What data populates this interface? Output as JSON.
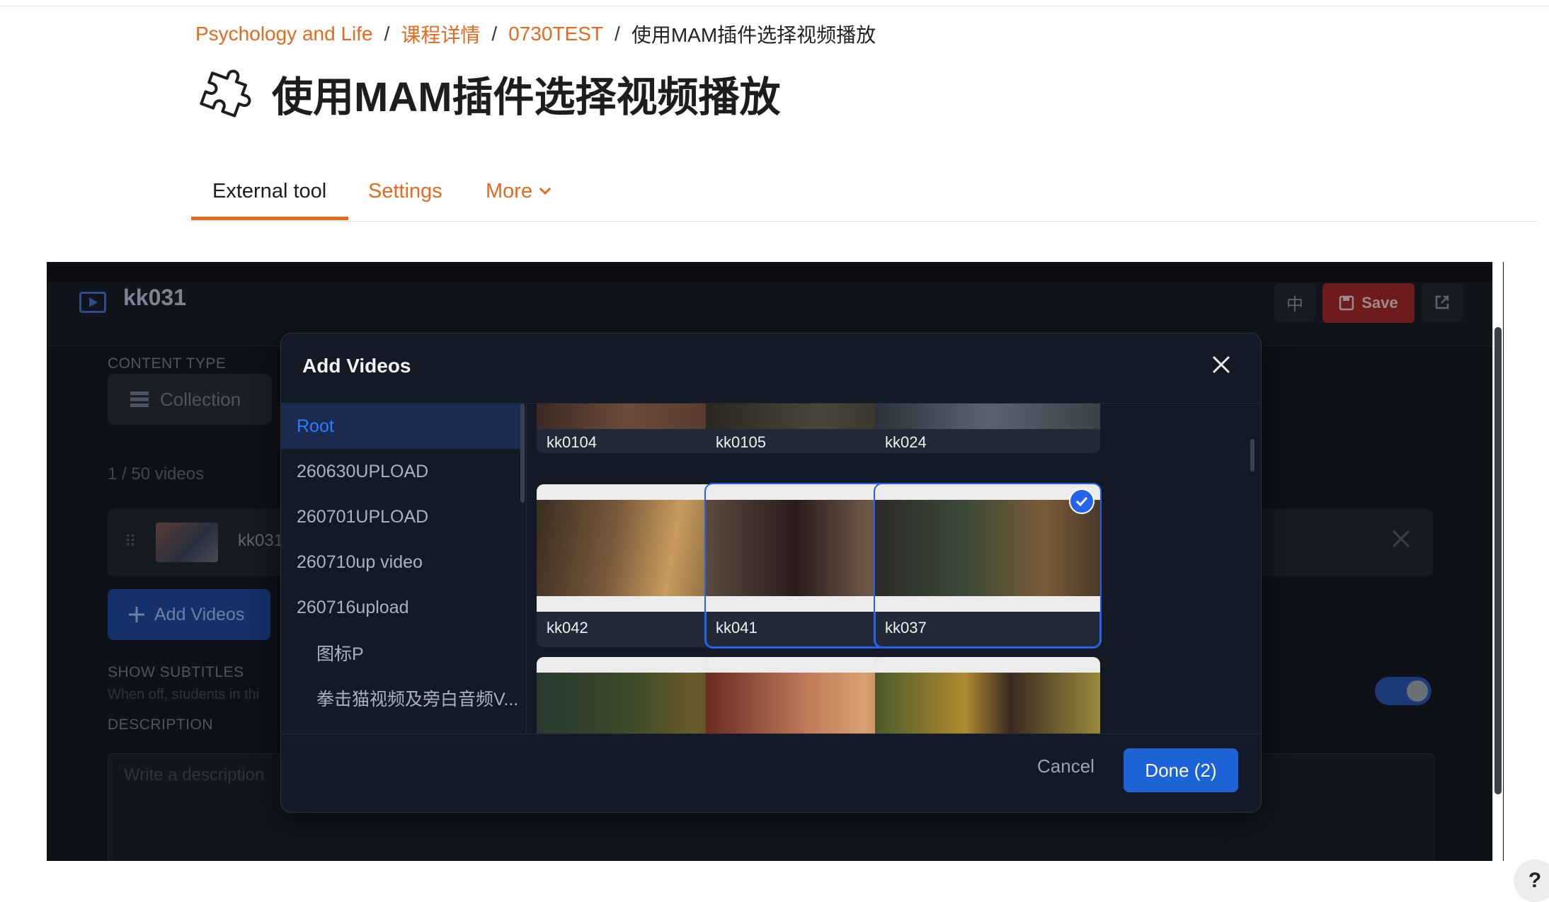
{
  "breadcrumb": {
    "course": "Psychology and Life",
    "details": "课程详情",
    "section": "0730TEST",
    "current": "使用MAM插件选择视频播放",
    "separator": "/"
  },
  "page": {
    "title": "使用MAM插件选择视频播放",
    "icon": "puzzle-icon"
  },
  "tabs": {
    "external_tool": "External tool",
    "settings": "Settings",
    "more": "More"
  },
  "tool": {
    "title": "kk031",
    "lang": "中",
    "save": "Save",
    "content_type_label": "CONTENT TYPE",
    "collection": "Collection",
    "count": "1 / 50 videos",
    "row_name": "kk031",
    "add_videos": "Add Videos",
    "subtitles_label": "SHOW SUBTITLES",
    "subtitles_hint": "When off, students in thi",
    "description_label": "DESCRIPTION",
    "description_placeholder": "Write a description"
  },
  "modal": {
    "title": "Add Videos",
    "folders": [
      {
        "name": "Root",
        "active": true
      },
      {
        "name": "260630UPLOAD"
      },
      {
        "name": "260701UPLOAD"
      },
      {
        "name": "260710up video"
      },
      {
        "name": "260716upload"
      },
      {
        "name": "图标P",
        "sub": true
      },
      {
        "name": "拳击猫视频及旁白音频V...",
        "sub": true
      }
    ],
    "videos": [
      {
        "name": "kk0104"
      },
      {
        "name": "kk0105"
      },
      {
        "name": "kk024"
      },
      {
        "name": "kk042"
      },
      {
        "name": "kk041",
        "selected": true
      },
      {
        "name": "kk037",
        "selected": true
      }
    ],
    "cancel": "Cancel",
    "done": "Done (2)"
  },
  "help": "?",
  "colors": {
    "accent": "#e36a1e",
    "primary": "#1d63d8",
    "modal_bg": "#131a26"
  }
}
